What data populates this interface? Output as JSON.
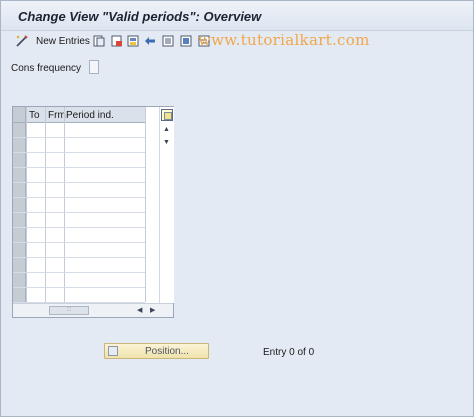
{
  "window": {
    "title": "Change View \"Valid periods\": Overview"
  },
  "toolbar": {
    "new_entries_label": "New Entries",
    "watermark": "www.tutorialkart.com",
    "icons": [
      "other-view-icon",
      "copy-icon",
      "save-as-icon",
      "undo-icon",
      "select-all-icon",
      "select-block-icon",
      "deselect-all-icon"
    ]
  },
  "filter": {
    "label": "Cons frequency",
    "value": ""
  },
  "table": {
    "columns": [
      "To",
      "Frm",
      "Period ind."
    ],
    "visible_rows": 12,
    "scroll_thumb": ":::"
  },
  "footer": {
    "position_button": "Position...",
    "entry_status": "Entry 0 of 0"
  }
}
